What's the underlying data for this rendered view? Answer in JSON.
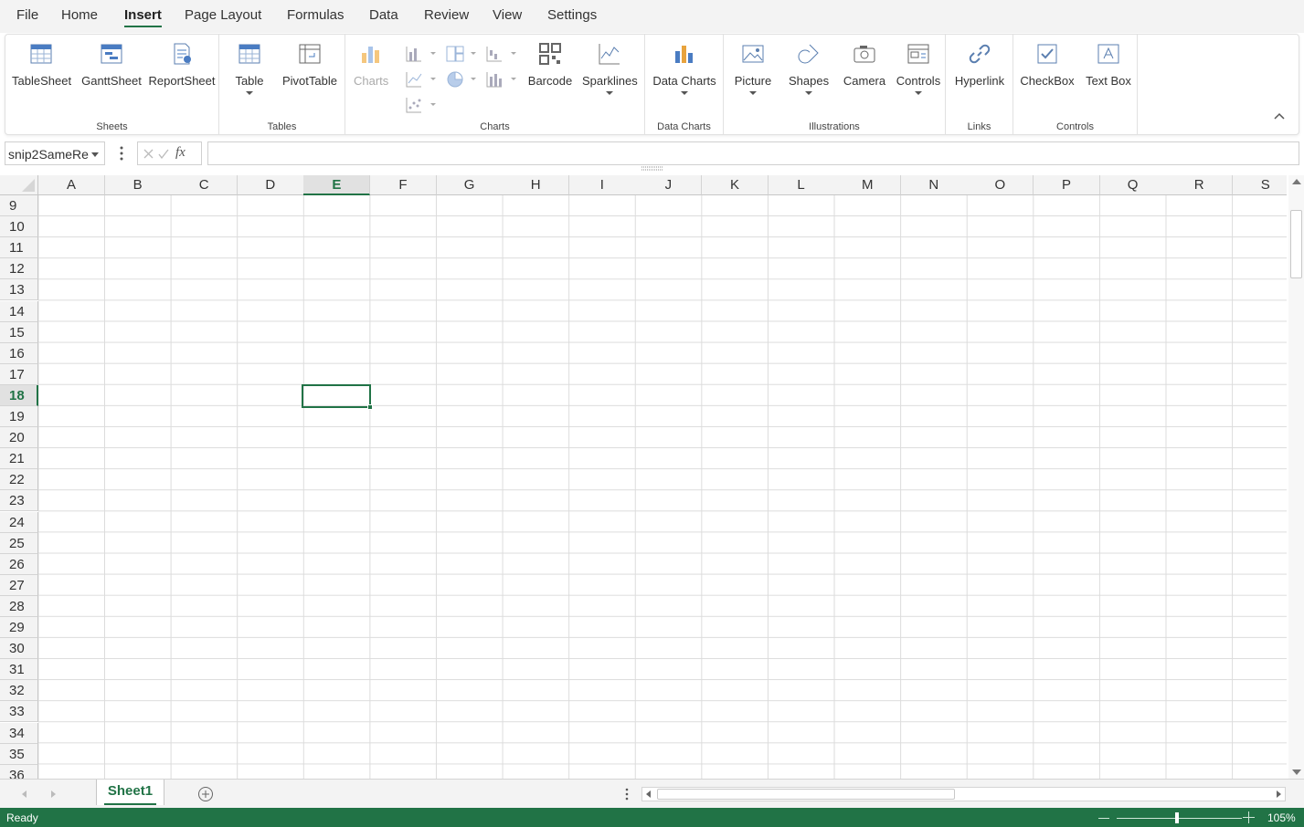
{
  "menu": {
    "tabs": [
      "File",
      "Home",
      "Insert",
      "Page Layout",
      "Formulas",
      "Data",
      "Review",
      "View",
      "Settings"
    ],
    "active": "Insert"
  },
  "ribbon": {
    "groups": {
      "sheets": "Sheets",
      "tables": "Tables",
      "charts": "Charts",
      "data_charts": "Data Charts",
      "illustrations": "Illustrations",
      "links": "Links",
      "controls": "Controls"
    },
    "buttons": {
      "tablesheet": "TableSheet",
      "ganttsheet": "GanttSheet",
      "reportsheet": "ReportSheet",
      "table": "Table",
      "pivottable": "PivotTable",
      "charts": "Charts",
      "barcode": "Barcode",
      "sparklines": "Sparklines",
      "data_charts": "Data Charts",
      "picture": "Picture",
      "shapes": "Shapes",
      "camera": "Camera",
      "controls": "Controls",
      "hyperlink": "Hyperlink",
      "checkbox": "CheckBox",
      "textbox": "Text Box"
    }
  },
  "formula_bar": {
    "name_box": "snip2SameRe",
    "fx_label": "fx",
    "formula": ""
  },
  "grid": {
    "columns": [
      "A",
      "B",
      "C",
      "D",
      "E",
      "F",
      "G",
      "H",
      "I",
      "J",
      "K",
      "L",
      "M",
      "N",
      "O",
      "P",
      "Q",
      "R",
      "S"
    ],
    "rows": [
      "9",
      "10",
      "11",
      "12",
      "13",
      "14",
      "15",
      "16",
      "17",
      "18",
      "19",
      "20",
      "21",
      "22",
      "23",
      "24",
      "25",
      "26",
      "27",
      "28",
      "29",
      "30",
      "31",
      "32",
      "33",
      "34",
      "35",
      "36"
    ],
    "active_column": "E",
    "active_row": "18"
  },
  "sheets": {
    "tabs": [
      "Sheet1"
    ],
    "active": "Sheet1"
  },
  "status": {
    "ready": "Ready",
    "zoom": "105%"
  },
  "colors": {
    "accent": "#217346"
  }
}
